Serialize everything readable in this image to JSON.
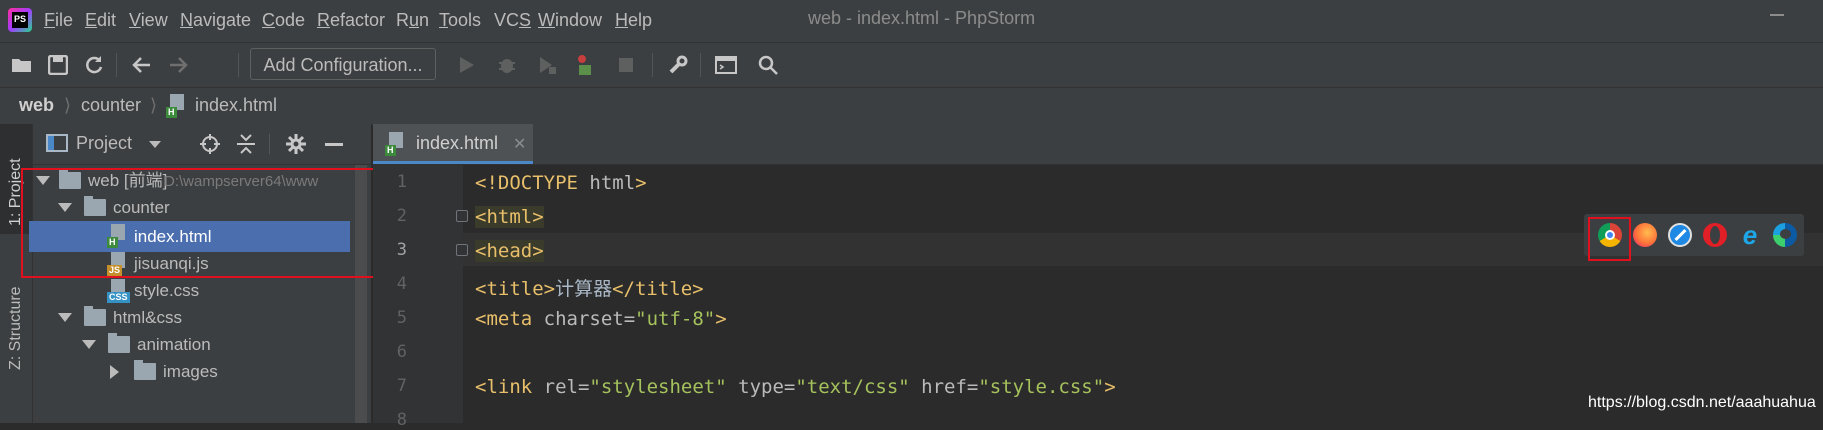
{
  "app": {
    "logo_text": "PS",
    "window_title": "web - index.html - PhpStorm"
  },
  "menu": [
    {
      "label": "File",
      "mnemonic": "F"
    },
    {
      "label": "Edit",
      "mnemonic": "E"
    },
    {
      "label": "View",
      "mnemonic": "V"
    },
    {
      "label": "Navigate",
      "mnemonic": "N"
    },
    {
      "label": "Code",
      "mnemonic": "C"
    },
    {
      "label": "Refactor",
      "mnemonic": "R"
    },
    {
      "label": "Run",
      "mnemonic": "u"
    },
    {
      "label": "Tools",
      "mnemonic": "T"
    },
    {
      "label": "VCS",
      "mnemonic": "S"
    },
    {
      "label": "Window",
      "mnemonic": "W"
    },
    {
      "label": "Help",
      "mnemonic": "H"
    }
  ],
  "toolbar": {
    "add_configuration_label": "Add Configuration..."
  },
  "breadcrumb": {
    "items": [
      "web",
      "counter",
      "index.html"
    ]
  },
  "tool_strip": {
    "project_label": "1: Project",
    "structure_label": "Z: Structure"
  },
  "project_panel": {
    "title": "Project",
    "tree": [
      {
        "label": "web [前端]",
        "hint": "D:\\wampserver64\\www",
        "type": "folder",
        "expanded": true
      },
      {
        "label": "counter",
        "type": "folder",
        "expanded": true
      },
      {
        "label": "index.html",
        "type": "html",
        "selected": true
      },
      {
        "label": "jisuanqi.js",
        "type": "js"
      },
      {
        "label": "style.css",
        "type": "css"
      },
      {
        "label": "html&css",
        "type": "folder",
        "expanded": true
      },
      {
        "label": "animation",
        "type": "folder",
        "expanded": true
      },
      {
        "label": "images",
        "type": "folder",
        "expanded": false
      }
    ]
  },
  "editor": {
    "tab_label": "index.html",
    "current_line": 3,
    "line_numbers": [
      "1",
      "2",
      "3",
      "4",
      "5",
      "6",
      "7",
      "8"
    ],
    "lines": {
      "l1_tag": "<!DOCTYPE ",
      "l1_rest": "html",
      "l1_close": ">",
      "l2": "<html>",
      "l3": "<head>",
      "l4_open": "<title>",
      "l4_text": "计算器",
      "l4_close": "</title>",
      "l5_tag": "<meta ",
      "l5_attr": "charset=",
      "l5_str": "\"utf-8\"",
      "l5_close": ">",
      "l7_tag": "<link ",
      "l7_attr1": "rel=",
      "l7_str1": "\"stylesheet\"",
      "l7_attr2": " type=",
      "l7_str2": "\"text/css\"",
      "l7_attr3": " href=",
      "l7_str3": "\"style.css\"",
      "l7_close": ">"
    }
  },
  "browser_popup": {
    "browsers": [
      "chrome-icon",
      "firefox-icon",
      "safari-icon",
      "opera-icon",
      "internet-explorer-icon",
      "edge-icon"
    ]
  },
  "watermark": "https://blog.csdn.net/aaahuahua",
  "colors": {
    "accent_selection": "#4b6eaf",
    "annotation_red": "#e0101f",
    "tag_color": "#e8bf6a",
    "string_color": "#a5c25c"
  }
}
